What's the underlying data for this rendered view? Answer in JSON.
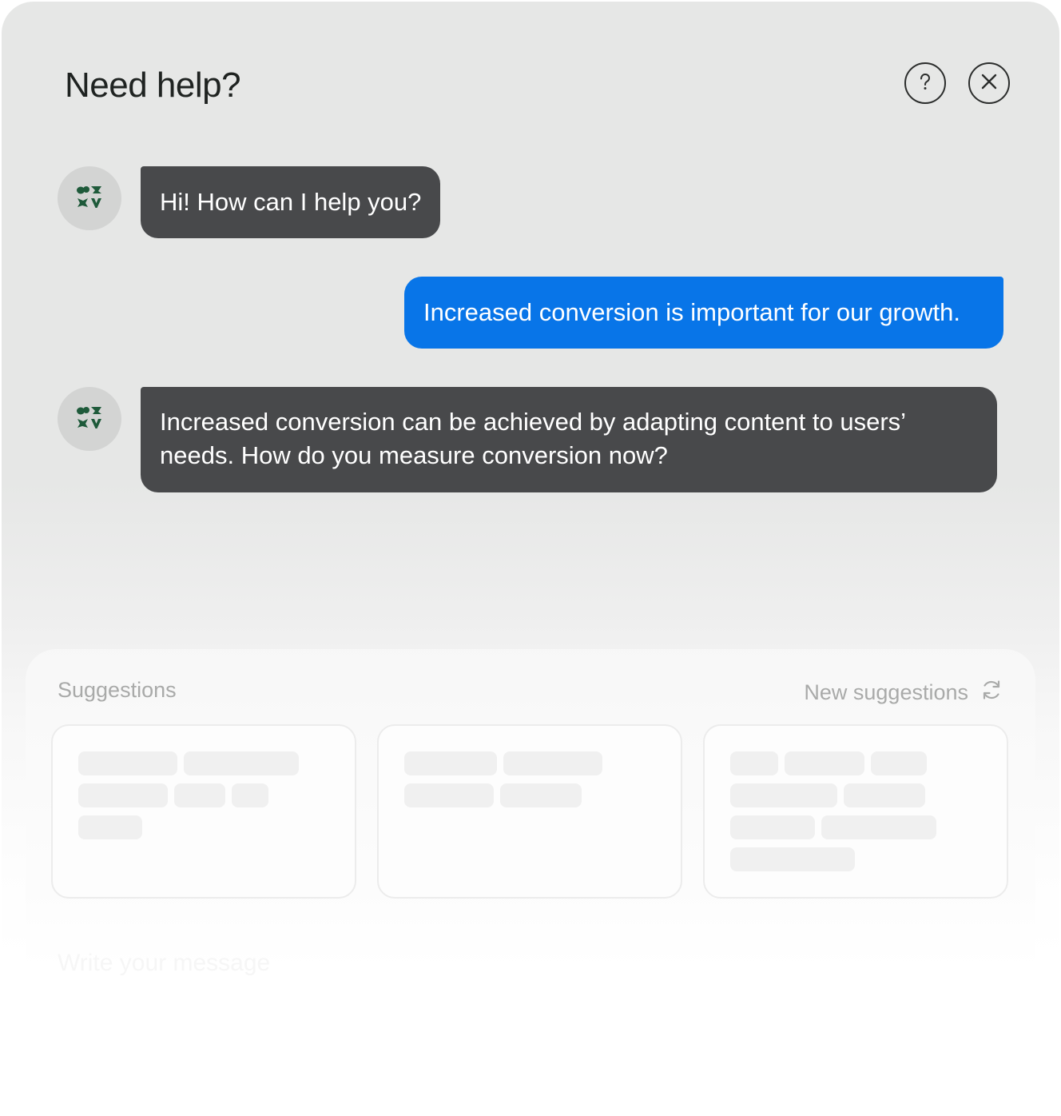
{
  "header": {
    "title": "Need help?",
    "help_icon": "question-circle-icon",
    "close_icon": "close-circle-icon"
  },
  "messages": [
    {
      "sender": "assistant",
      "text": "Hi! How can I help you?"
    },
    {
      "sender": "user",
      "text": "Increased conversion is important for our growth."
    },
    {
      "sender": "assistant",
      "text": "Increased conversion can be achieved by adapting content to users’ needs. How do you measure conversion now?"
    }
  ],
  "suggestions": {
    "label": "Suggestions",
    "refresh_label": "New suggestions",
    "refresh_icon": "refresh-icon",
    "cards_loading": 3
  },
  "composer": {
    "placeholder": "Write your message"
  },
  "colors": {
    "bot_bubble": "#48494b",
    "user_bubble": "#0875e8",
    "avatar_logo": "#1e5a3a"
  }
}
